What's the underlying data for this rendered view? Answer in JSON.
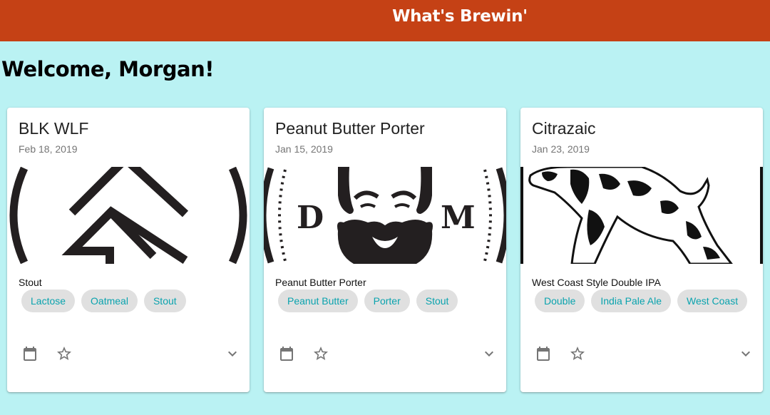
{
  "header": {
    "app_title": "What's Brewin'"
  },
  "welcome": "Welcome, Morgan!",
  "colors": {
    "header_bg": "#c54115",
    "page_bg": "#baf2f3",
    "chip_text": "#0aa3ae",
    "chip_bg": "#e0e0e0"
  },
  "cards": [
    {
      "title": "BLK WLF",
      "date": "Feb 18, 2019",
      "style": "Stout",
      "image": "wolf-logo",
      "tags": [
        "Lactose",
        "Oatmeal",
        "Stout"
      ]
    },
    {
      "title": "Peanut Butter Porter",
      "date": "Jan 15, 2019",
      "style": "Peanut Butter Porter",
      "image": "bearded-man-logo",
      "tags": [
        "Peanut Butter",
        "Porter",
        "Stout"
      ]
    },
    {
      "title": "Citrazaic",
      "date": "Jan 23, 2019",
      "style": "West Coast Style Double IPA",
      "image": "pointer-dog-illustration",
      "tags": [
        "Double",
        "India Pale Ale",
        "West Coast"
      ]
    }
  ],
  "icons": {
    "calendar": "calendar-icon",
    "favorite": "star-outline-icon",
    "expand": "chevron-down-icon"
  }
}
